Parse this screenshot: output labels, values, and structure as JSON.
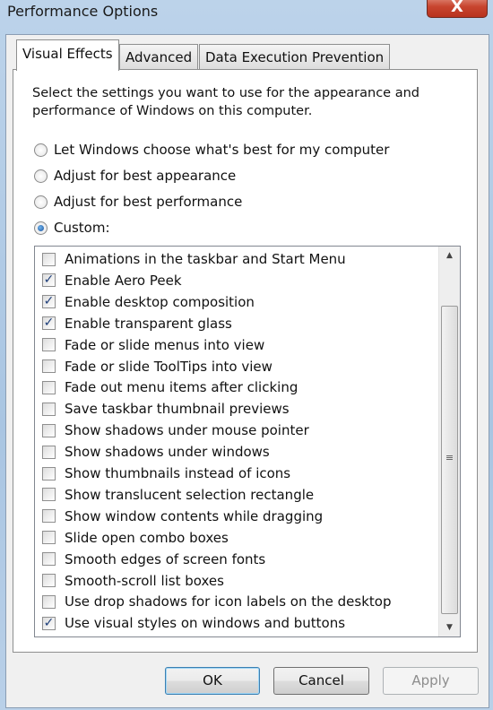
{
  "window": {
    "title": "Performance Options",
    "close_label": "X"
  },
  "tabs": [
    {
      "label": "Visual Effects",
      "active": true
    },
    {
      "label": "Advanced",
      "active": false
    },
    {
      "label": "Data Execution Prevention",
      "active": false
    }
  ],
  "description": "Select the settings you want to use for the appearance and performance of Windows on this computer.",
  "radios": [
    {
      "label": "Let Windows choose what's best for my computer",
      "selected": false
    },
    {
      "label": "Adjust for best appearance",
      "selected": false
    },
    {
      "label": "Adjust for best performance",
      "selected": false
    },
    {
      "label": "Custom:",
      "selected": true
    }
  ],
  "options": [
    {
      "label": "Animations in the taskbar and Start Menu",
      "checked": false
    },
    {
      "label": "Enable Aero Peek",
      "checked": true
    },
    {
      "label": "Enable desktop composition",
      "checked": true
    },
    {
      "label": "Enable transparent glass",
      "checked": true
    },
    {
      "label": "Fade or slide menus into view",
      "checked": false
    },
    {
      "label": "Fade or slide ToolTips into view",
      "checked": false
    },
    {
      "label": "Fade out menu items after clicking",
      "checked": false
    },
    {
      "label": "Save taskbar thumbnail previews",
      "checked": false
    },
    {
      "label": "Show shadows under mouse pointer",
      "checked": false
    },
    {
      "label": "Show shadows under windows",
      "checked": false
    },
    {
      "label": "Show thumbnails instead of icons",
      "checked": false
    },
    {
      "label": "Show translucent selection rectangle",
      "checked": false
    },
    {
      "label": "Show window contents while dragging",
      "checked": false
    },
    {
      "label": "Slide open combo boxes",
      "checked": false
    },
    {
      "label": "Smooth edges of screen fonts",
      "checked": false
    },
    {
      "label": "Smooth-scroll list boxes",
      "checked": false
    },
    {
      "label": "Use drop shadows for icon labels on the desktop",
      "checked": false
    },
    {
      "label": "Use visual styles on windows and buttons",
      "checked": true
    }
  ],
  "buttons": {
    "ok": "OK",
    "cancel": "Cancel",
    "apply": "Apply"
  }
}
